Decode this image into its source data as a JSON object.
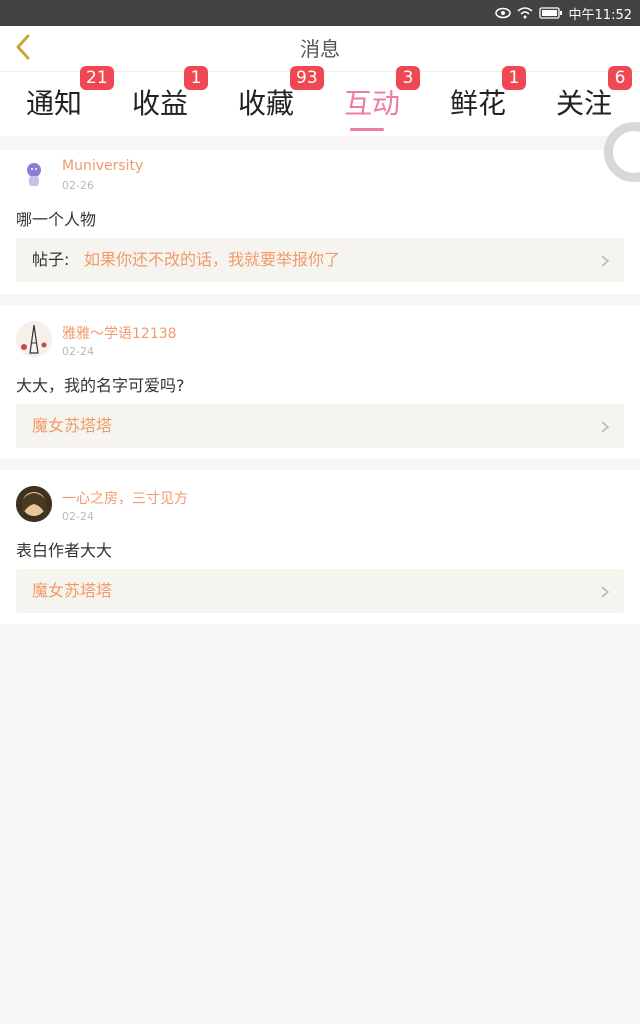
{
  "status_bar": {
    "time": "中午11:52",
    "icons": [
      "eye-icon",
      "wifi-icon",
      "battery-icon"
    ]
  },
  "header": {
    "title": "消息",
    "back_icon": "chevron-left-icon"
  },
  "tabs": [
    {
      "label": "通知",
      "badge": "21",
      "active": false
    },
    {
      "label": "收益",
      "badge": "1",
      "active": false
    },
    {
      "label": "收藏",
      "badge": "93",
      "active": false
    },
    {
      "label": "互动",
      "badge": "3",
      "active": true
    },
    {
      "label": "鲜花",
      "badge": "1",
      "active": false
    },
    {
      "label": "关注",
      "badge": "6",
      "active": false
    }
  ],
  "items": [
    {
      "username": "Muniversity",
      "date": "02-26",
      "message": "哪一个人物",
      "ref_prefix": "帖子:",
      "ref_text": "如果你还不改的话，我就要举报你了"
    },
    {
      "username": "雅雅～学语12138",
      "date": "02-24",
      "message": "大大，我的名字可爱吗?",
      "ref_prefix": "",
      "ref_text": "魔女苏塔塔"
    },
    {
      "username": "一心之房，三寸见方",
      "date": "02-24",
      "message": "表白作者大大",
      "ref_prefix": "",
      "ref_text": "魔女苏塔塔"
    }
  ],
  "colors": {
    "accent_pink": "#f07aa6",
    "badge_red": "#f04852",
    "username_orange": "#f19a6b",
    "ref_bg": "#f5f4ee"
  }
}
